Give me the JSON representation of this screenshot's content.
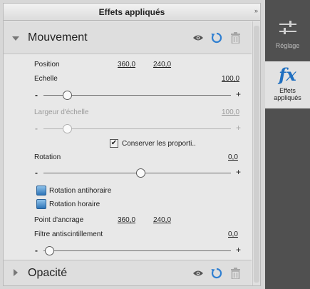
{
  "panel": {
    "title": "Effets appliqués",
    "menu_glyph": "»"
  },
  "motion": {
    "title": "Mouvement",
    "position": {
      "label": "Position",
      "x": "360,0",
      "y": "240,0"
    },
    "scale": {
      "label": "Echelle",
      "value": "100,0"
    },
    "scale_width": {
      "label": "Largeur d'échelle",
      "value": "100,0"
    },
    "keep_proportions": {
      "label": "Conserver les proporti..",
      "checked": true
    },
    "rotation": {
      "label": "Rotation",
      "value": "0,0"
    },
    "rotate_ccw": "Rotation antihoraire",
    "rotate_cw": "Rotation horaire",
    "anchor": {
      "label": "Point d'ancrage",
      "x": "360,0",
      "y": "240,0"
    },
    "flicker": {
      "label": "Filtre antiscintillement",
      "value": "0,0"
    }
  },
  "opacity": {
    "title": "Opacité"
  },
  "slider": {
    "minus": "-",
    "plus": "+"
  },
  "sidebar": {
    "adjust_label": "Réglage",
    "effects_label_1": "Effets",
    "effects_label_2": "appliqués"
  },
  "colors": {
    "accent": "#1f6fc0",
    "sidebar_bg": "#505050",
    "panel_bg": "#e8e8e8"
  }
}
